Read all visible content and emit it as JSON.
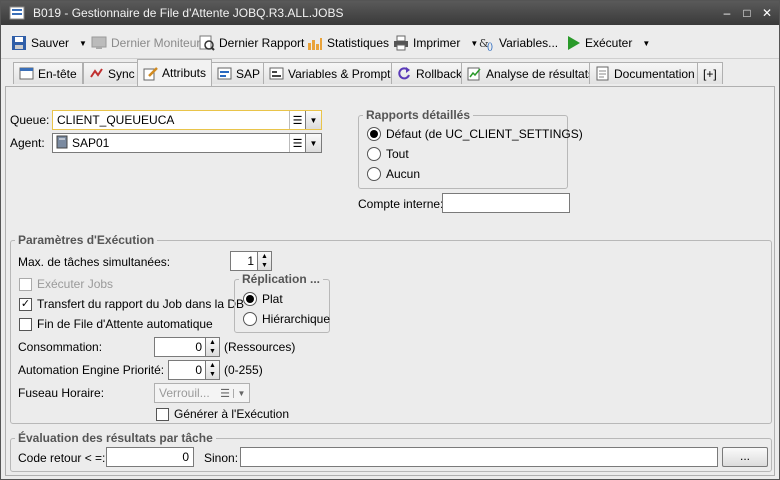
{
  "window": {
    "title": "B019 - Gestionnaire de File d'Attente JOBQ.R3.ALL.JOBS",
    "controls": {
      "minimize": "–",
      "maximize": "□",
      "close": "✕"
    }
  },
  "toolbar": {
    "save": "Sauver",
    "last_monitor": "Dernier Moniteur",
    "last_report": "Dernier Rapport",
    "statistics": "Statistiques",
    "print": "Imprimer",
    "variables": "Variables...",
    "execute": "Exécuter"
  },
  "tabs": [
    {
      "label": "En-tête"
    },
    {
      "label": "Sync"
    },
    {
      "label": "Attributs",
      "active": true
    },
    {
      "label": "SAP"
    },
    {
      "label": "Variables & Prompts"
    },
    {
      "label": "Rollback"
    },
    {
      "label": "Analyse de résultats"
    },
    {
      "label": "Documentation"
    },
    {
      "label": "[+]"
    }
  ],
  "attributes": {
    "queue_label": "Queue:",
    "queue_value": "CLIENT_QUEUEUCA",
    "agent_label": "Agent:",
    "agent_value": "SAP01"
  },
  "reports": {
    "title": "Rapports détaillés",
    "options": [
      "Défaut (de UC_CLIENT_SETTINGS)",
      "Tout",
      "Aucun"
    ],
    "selected": "Défaut (de UC_CLIENT_SETTINGS)",
    "internal_account_label": "Compte interne:",
    "internal_account_value": ""
  },
  "execution": {
    "title": "Paramètres d'Exécution",
    "max_tasks_label": "Max. de tâches simultanées:",
    "max_tasks_value": "1",
    "execute_jobs": "Exécuter Jobs",
    "execute_jobs_checked": false,
    "transfer_report": "Transfert du rapport du Job dans la DB",
    "transfer_report_checked": true,
    "auto_end": "Fin de File d'Attente automatique",
    "auto_end_checked": false,
    "consumption_label": "Consommation:",
    "consumption_value": "0",
    "consumption_unit": "(Ressources)",
    "priority_label": "Automation Engine Priorité:",
    "priority_value": "0",
    "priority_range": "(0-255)",
    "timezone_label": "Fuseau Horaire:",
    "timezone_placeholder": "Verrouil...",
    "generate_at_exec": "Générer à l'Exécution",
    "generate_at_exec_checked": false
  },
  "replication": {
    "title": "Réplication ...",
    "options": [
      "Plat",
      "Hiérarchique"
    ],
    "selected": "Plat"
  },
  "evaluation": {
    "title": "Évaluation des résultats par tâche",
    "return_code_label": "Code retour < =:",
    "return_code_value": "0",
    "else_label": "Sinon:",
    "else_value": "",
    "browse_button": "..."
  },
  "colors": {
    "accent": "#e9c44a",
    "titlebar": "#4a4a4a",
    "execute_green": "#2a9a2a"
  }
}
